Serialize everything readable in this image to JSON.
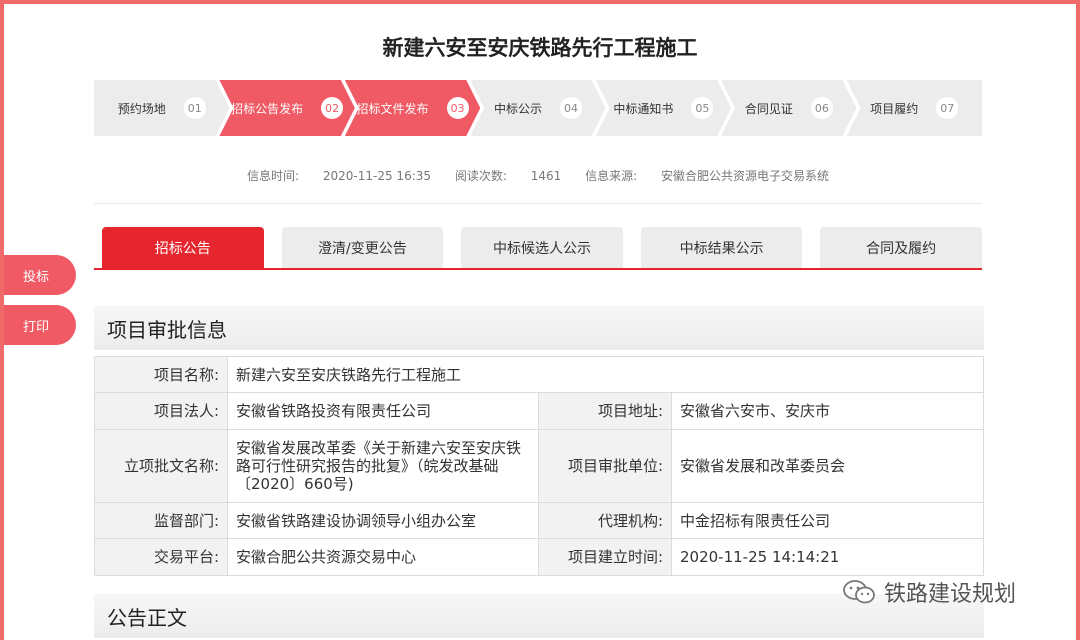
{
  "title": "新建六安至安庆铁路先行工程施工",
  "steps": [
    {
      "label": "预约场地",
      "num": "01"
    },
    {
      "label": "招标公告发布",
      "num": "02"
    },
    {
      "label": "招标文件发布",
      "num": "03"
    },
    {
      "label": "中标公示",
      "num": "04"
    },
    {
      "label": "中标通知书",
      "num": "05"
    },
    {
      "label": "合同见证",
      "num": "06"
    },
    {
      "label": "项目履约",
      "num": "07"
    }
  ],
  "meta": {
    "time_label": "信息时间:",
    "time_value": "2020-11-25 16:35",
    "reads_label": "阅读次数:",
    "reads_value": "1461",
    "source_label": "信息来源:",
    "source_value": "安徽合肥公共资源电子交易系统"
  },
  "tabs": [
    {
      "label": "招标公告"
    },
    {
      "label": "澄清/变更公告"
    },
    {
      "label": "中标候选人公示"
    },
    {
      "label": "中标结果公示"
    },
    {
      "label": "合同及履约"
    }
  ],
  "side": {
    "bid_label": "投标",
    "print_label": "打印"
  },
  "sections": {
    "approval": "项目审批信息",
    "body": "公告正文"
  },
  "info": {
    "name_label": "项目名称:",
    "name_value": "新建六安至安庆铁路先行工程施工",
    "legal_label": "项目法人:",
    "legal_value": "安徽省铁路投资有限责任公司",
    "address_label": "项目地址:",
    "address_value": "安徽省六安市、安庆市",
    "doc_label": "立项批文名称:",
    "doc_value": "安徽省发展改革委《关于新建六安至安庆铁路可行性研究报告的批复》（皖发改基础〔2020〕660号)",
    "approver_label": "项目审批单位:",
    "approver_value": "安徽省发展和改革委员会",
    "supervisor_label": "监督部门:",
    "supervisor_value": "安徽省铁路建设协调领导小组办公室",
    "agency_label": "代理机构:",
    "agency_value": "中金招标有限责任公司",
    "platform_label": "交易平台:",
    "platform_value": "安徽合肥公共资源交易中心",
    "created_label": "项目建立时间:",
    "created_value": "2020-11-25 14:14:21"
  },
  "watermark": "铁路建设规划",
  "colors": {
    "accent": "#e6262e",
    "step_active": "#f05a64",
    "inactive": "#ececec"
  }
}
